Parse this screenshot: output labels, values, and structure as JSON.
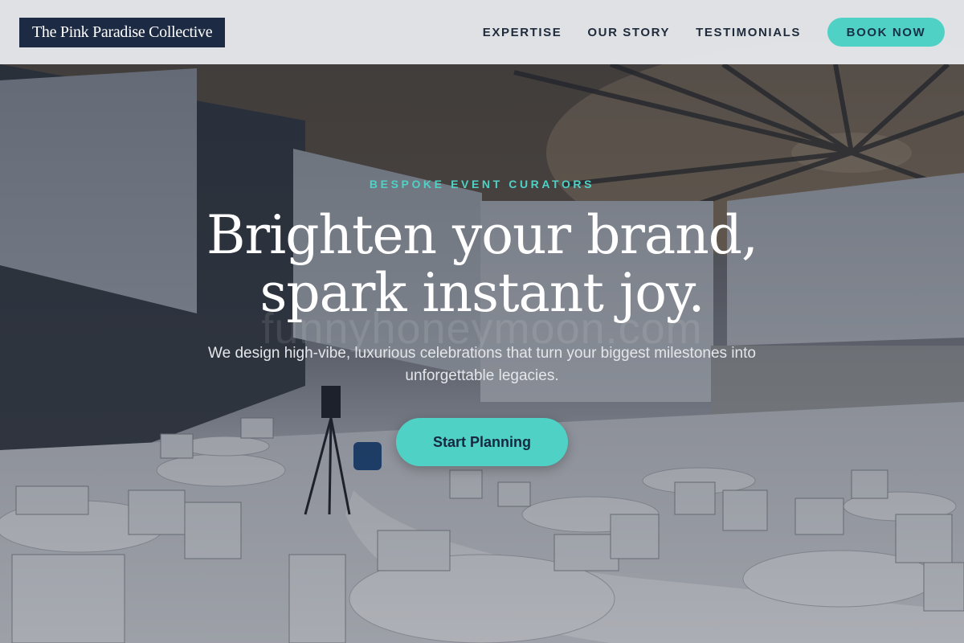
{
  "header": {
    "logo_text": "The Pink Paradise Collective",
    "nav": [
      {
        "label": "EXPERTISE"
      },
      {
        "label": "OUR STORY"
      },
      {
        "label": "TESTIMONIALS"
      }
    ],
    "book_label": "BOOK NOW"
  },
  "hero": {
    "eyebrow": "BESPOKE EVENT CURATORS",
    "headline_line1": "Brighten your brand,",
    "headline_line2": "spark instant joy.",
    "subtext": "We design high-vibe, luxurious celebrations that turn your biggest milestones into unforgettable legacies.",
    "cta_label": "Start Planning",
    "watermark": "funnyhoneymoon.com",
    "background_image": "conference-hall-photo"
  },
  "colors": {
    "accent": "#4fd1c5",
    "navy": "#1d2a43",
    "header_bg": "#eceef1",
    "headline": "#ffffff"
  }
}
